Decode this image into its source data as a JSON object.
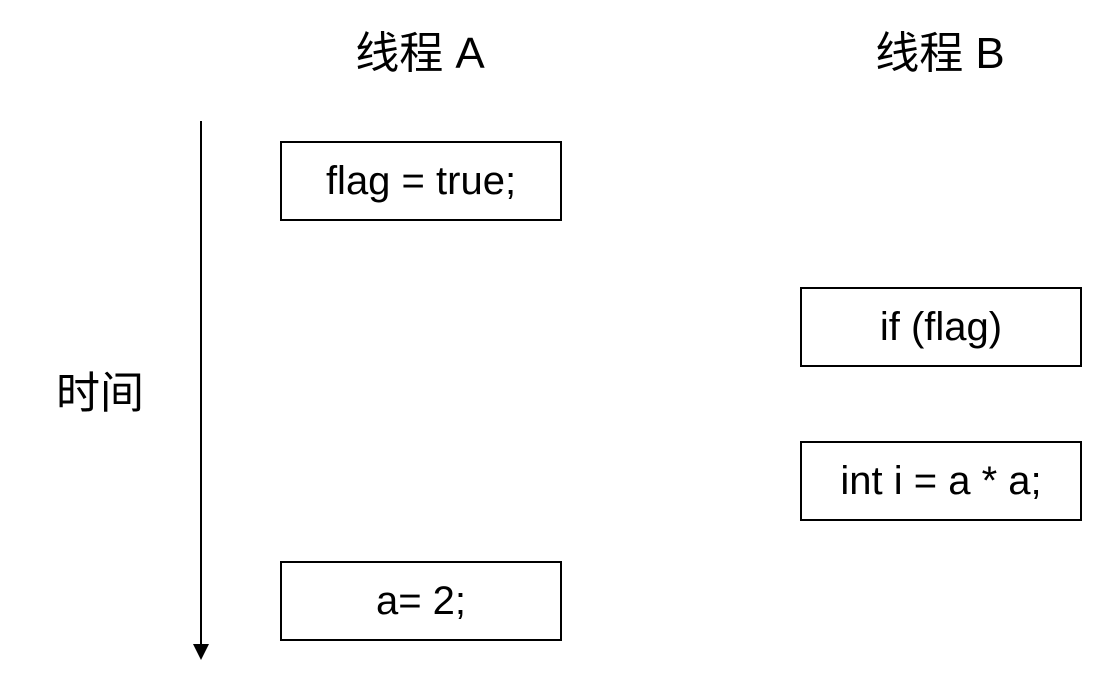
{
  "threads": [
    {
      "heading": "线程 A"
    },
    {
      "heading": "线程 B"
    }
  ],
  "time_axis": {
    "label": "时间"
  },
  "statements": {
    "thread_a": [
      "flag = true;",
      "a= 2;"
    ],
    "thread_b": [
      "if (flag)",
      "int i = a * a;"
    ]
  },
  "colors": {
    "line": "#000000",
    "background": "#ffffff"
  }
}
